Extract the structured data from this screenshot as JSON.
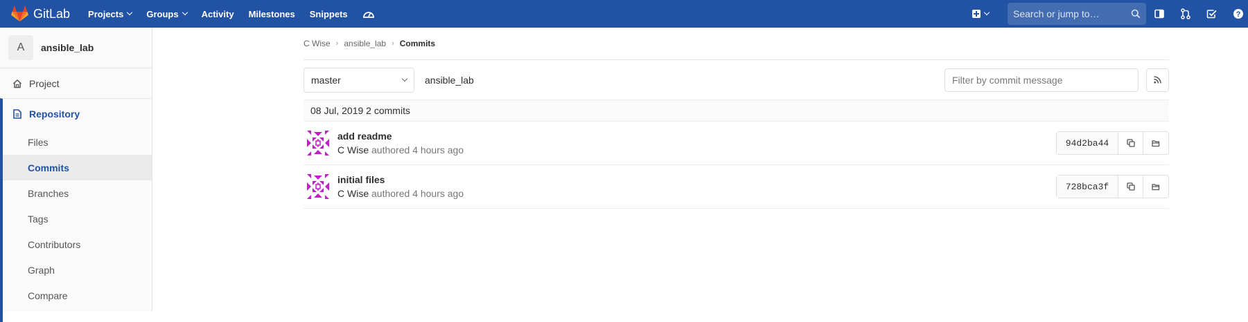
{
  "navbar": {
    "brand": "GitLab",
    "links": [
      {
        "label": "Projects",
        "dropdown": true
      },
      {
        "label": "Groups",
        "dropdown": true
      },
      {
        "label": "Activity",
        "dropdown": false
      },
      {
        "label": "Milestones",
        "dropdown": false
      },
      {
        "label": "Snippets",
        "dropdown": false
      }
    ],
    "search_placeholder": "Search or jump to…",
    "color": "#2152a3"
  },
  "sidebar": {
    "project_initial": "A",
    "project_name": "ansible_lab",
    "project_label": "Project",
    "repository_label": "Repository",
    "sub_items": [
      "Files",
      "Commits",
      "Branches",
      "Tags",
      "Contributors",
      "Graph",
      "Compare"
    ],
    "active_sub_item": "Commits"
  },
  "breadcrumb": {
    "items": [
      "C Wise",
      "ansible_lab"
    ],
    "current": "Commits"
  },
  "commits_bar": {
    "branch": "master",
    "path": "ansible_lab",
    "filter_placeholder": "Filter by commit message"
  },
  "day_header": "08 Jul, 2019 2 commits",
  "commits": [
    {
      "title": "add readme",
      "author": "C Wise",
      "authored_text": "authored",
      "time": "4 hours ago",
      "sha": "94d2ba44"
    },
    {
      "title": "initial files",
      "author": "C Wise",
      "authored_text": "authored",
      "time": "4 hours ago",
      "sha": "728bca3f"
    }
  ]
}
